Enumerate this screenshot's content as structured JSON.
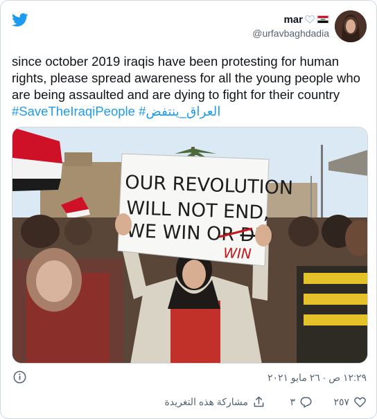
{
  "author": {
    "display_name": "mar",
    "handle": "@urfavbaghdadia"
  },
  "tweet": {
    "text": "since october 2019 iraqis have been protesting for human rights, please spread awareness for all the young people who are being assaulted and are dying to fight for their country ",
    "hashtag_en": "#SaveTheIraqiPeople",
    "hashtag_ar": "#العراق_ينتفض"
  },
  "media": {
    "sign_line_1": "OUR REVOLUTION",
    "sign_line_2": "WILL NOT END,",
    "sign_line_3": "WE WIN OR ",
    "sign_struck": "DIE",
    "sign_correction": "WIN"
  },
  "meta": {
    "timestamp": "١٢:٢٩ ص · ٢٦ مايو ٢٠٢١"
  },
  "actions": {
    "likes": "٢٥٧",
    "replies": "٣",
    "share_label": "مشاركة هذه التغريدة"
  },
  "icons": {
    "logo": "twitter-bird-icon",
    "info": "info-icon",
    "like": "heart-icon",
    "reply": "reply-icon",
    "share": "share-icon",
    "status": "white-heart-icon",
    "flag": "iraq-flag-icon"
  },
  "colors": {
    "brand": "#1d9bf0",
    "text": "#0f1419",
    "secondary": "#536471",
    "border": "#cfd9de"
  }
}
